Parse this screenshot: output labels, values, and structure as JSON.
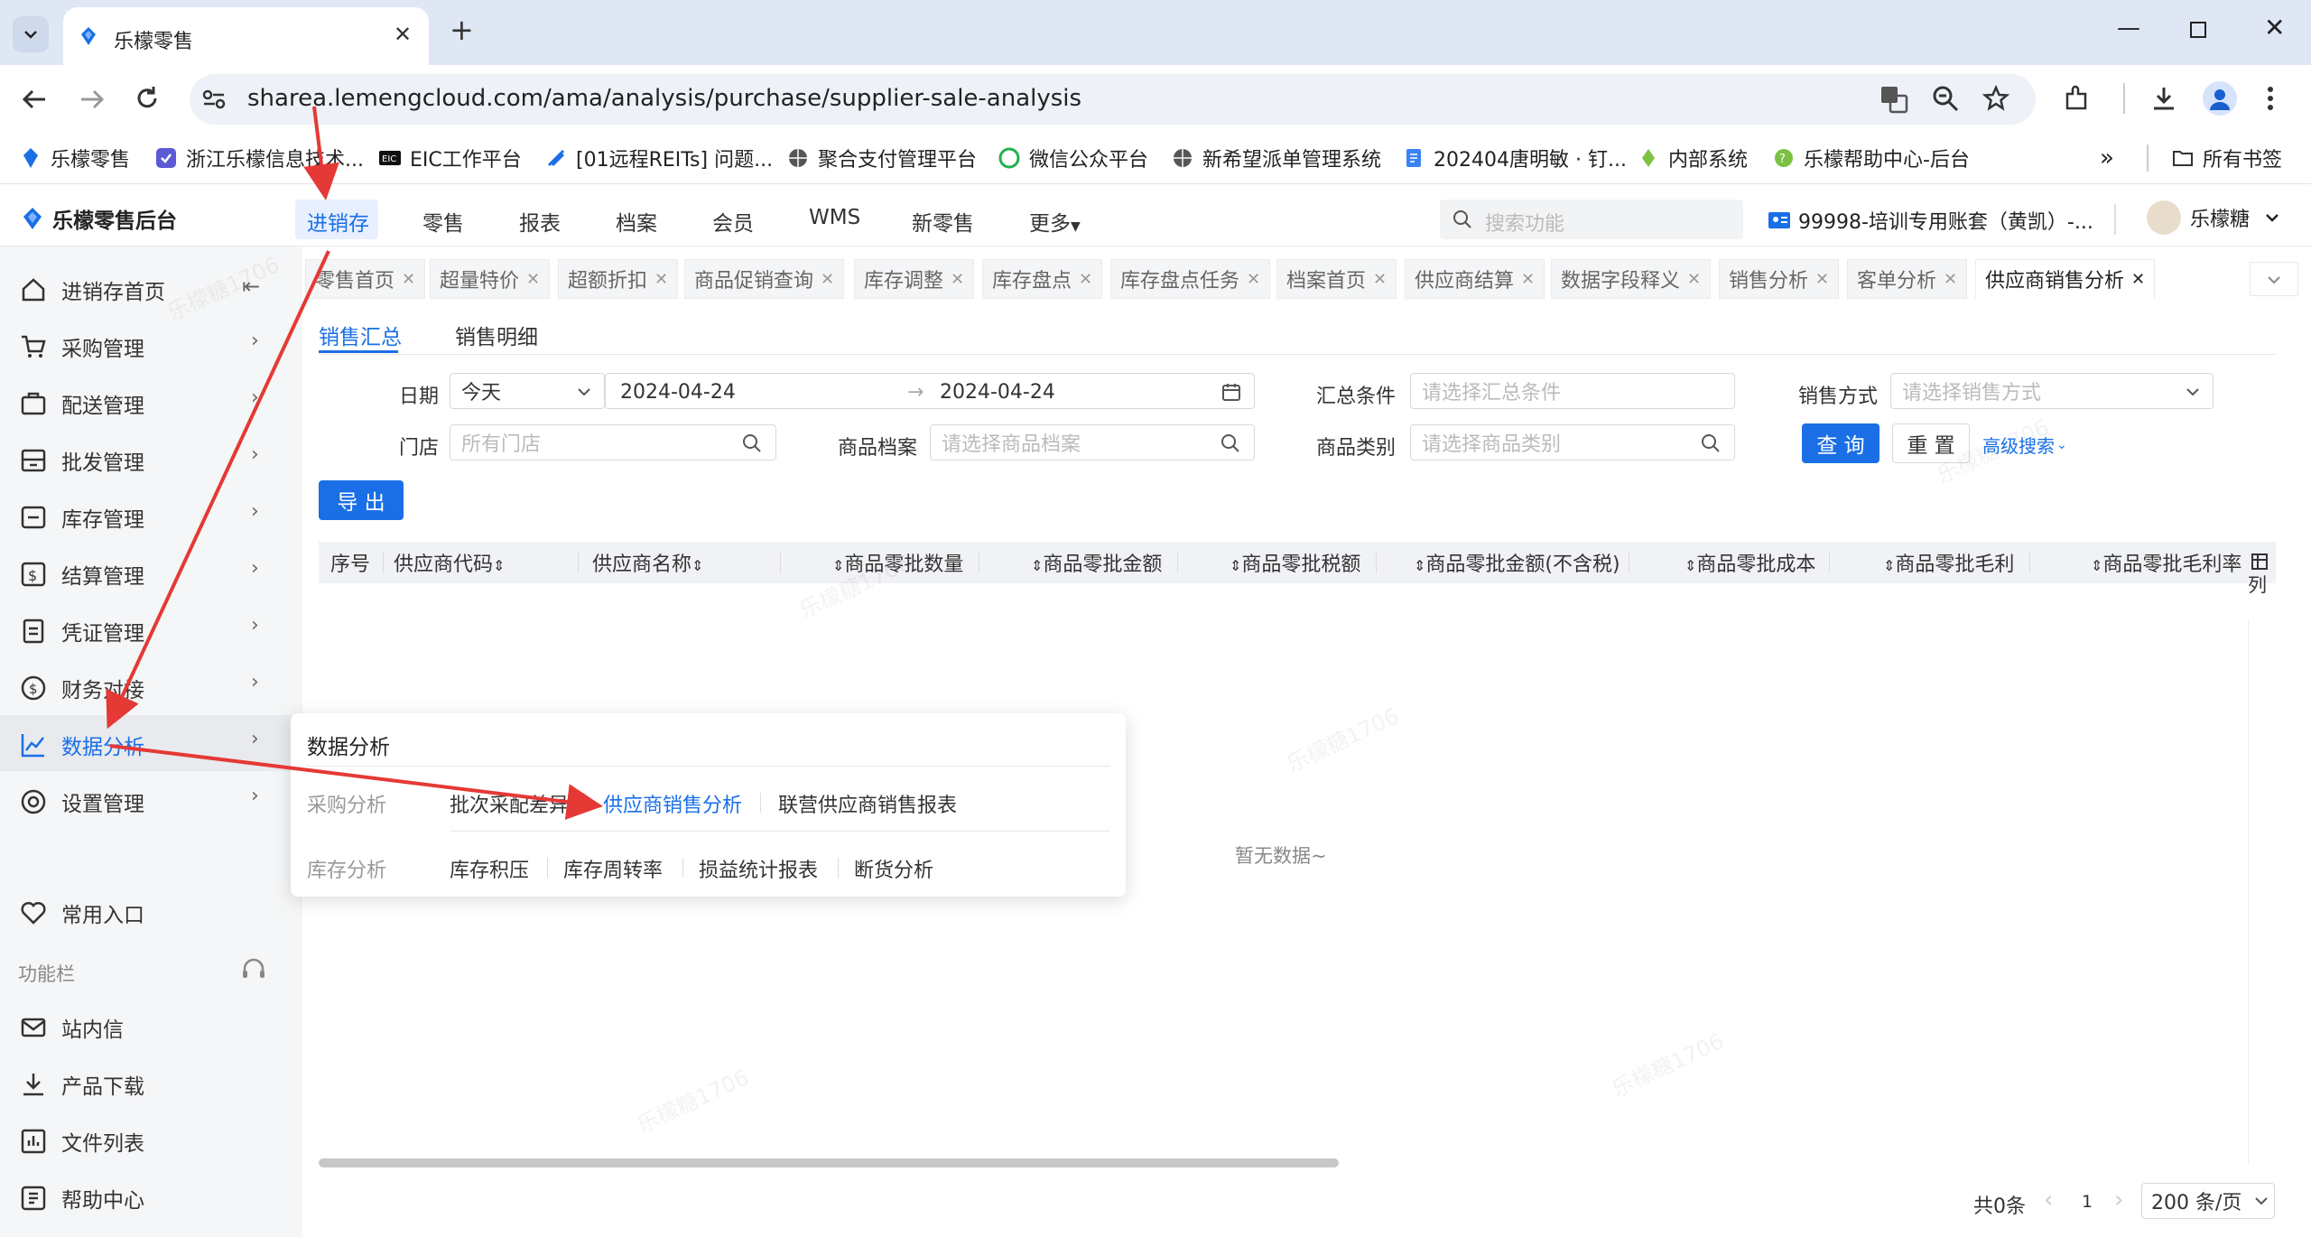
{
  "browser": {
    "tab_title": "乐檬零售",
    "new_tab": "+",
    "url": "sharea.lemengcloud.com/ama/analysis/purchase/supplier-sale-analysis",
    "bookmarks": [
      "乐檬零售",
      "浙江乐檬信息技术...",
      "EIC工作平台",
      "[01远程REITs] 问题...",
      "聚合支付管理平台",
      "微信公众平台",
      "新希望派单管理系统",
      "202404唐明敏 · 钉...",
      "内部系统",
      "乐檬帮助中心-后台"
    ],
    "more_bookmarks": "»",
    "all_bookmarks": "所有书签"
  },
  "app": {
    "logo_text": "乐檬零售后台",
    "nav": [
      "进销存",
      "零售",
      "报表",
      "档案",
      "会员",
      "WMS",
      "新零售",
      "更多"
    ],
    "search_placeholder": "搜索功能",
    "account": "99998-培训专用账套（黄凯）-...",
    "user": "乐檬糖"
  },
  "sidebar": {
    "items": [
      "进销存首页",
      "采购管理",
      "配送管理",
      "批发管理",
      "库存管理",
      "结算管理",
      "凭证管理",
      "财务对接",
      "数据分析",
      "设置管理"
    ],
    "common": "常用入口",
    "section": "功能栏",
    "bottom": [
      "站内信",
      "产品下载",
      "文件列表",
      "帮助中心"
    ]
  },
  "pagetabs": [
    "零售首页",
    "超量特价",
    "超额折扣",
    "商品促销查询",
    "库存调整",
    "库存盘点",
    "库存盘点任务",
    "档案首页",
    "供应商结算",
    "数据字段释义",
    "销售分析",
    "客单分析",
    "供应商销售分析"
  ],
  "subtabs": [
    "销售汇总",
    "销售明细"
  ],
  "filters": {
    "date_label": "日期",
    "date_preset": "今天",
    "date_start": "2024-04-24",
    "date_arrow": "→",
    "date_end": "2024-04-24",
    "summary_label": "汇总条件",
    "summary_placeholder": "请选择汇总条件",
    "sale_mode_label": "销售方式",
    "sale_mode_placeholder": "请选择销售方式",
    "store_label": "门店",
    "store_placeholder": "所有门店",
    "product_label": "商品档案",
    "product_placeholder": "请选择商品档案",
    "category_label": "商品类别",
    "category_placeholder": "请选择商品类别",
    "query": "查 询",
    "reset": "重 置",
    "advanced": "高级搜索"
  },
  "export": "导 出",
  "table": {
    "columns": [
      "序号",
      "供应商代码",
      "供应商名称",
      "商品零批数量",
      "商品零批金额",
      "商品零批税额",
      "商品零批金额(不含税)",
      "商品零批成本",
      "商品零批毛利",
      "商品零批毛利率"
    ],
    "column_setting": "列",
    "empty": "暂无数据~"
  },
  "pagination": {
    "total": "共0条",
    "page": "1",
    "size": "200 条/页"
  },
  "popup": {
    "title": "数据分析",
    "groups": [
      {
        "label": "采购分析",
        "links": [
          "批次采配差异",
          "供应商销售分析",
          "联营供应商销售报表"
        ]
      },
      {
        "label": "库存分析",
        "links": [
          "库存积压",
          "库存周转率",
          "损益统计报表",
          "断货分析"
        ]
      }
    ]
  },
  "watermark": "乐檬糖1706",
  "colors": {
    "primary": "#1a6fe6",
    "annotation": "#e53935"
  }
}
